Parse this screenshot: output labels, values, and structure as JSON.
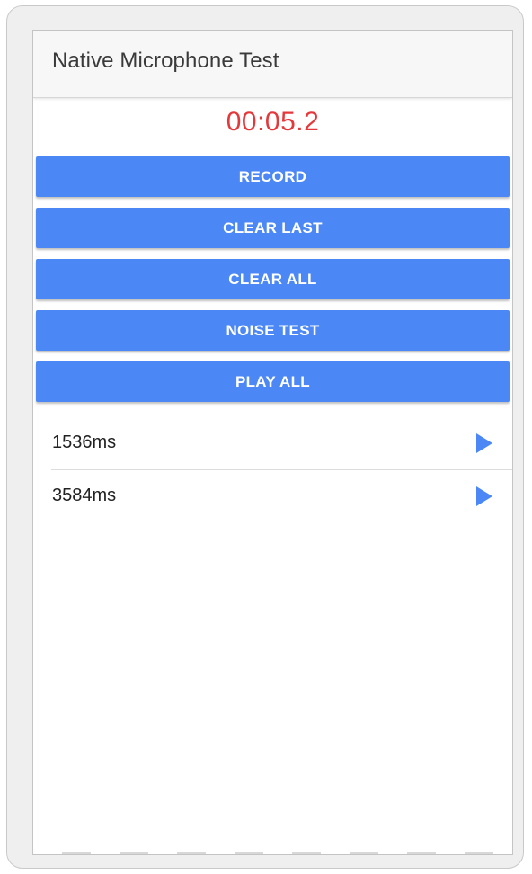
{
  "app": {
    "title": "Native Microphone Test"
  },
  "timer": {
    "value": "00:05.2",
    "color": "#e5383b"
  },
  "buttons": {
    "record": "RECORD",
    "clear_last": "CLEAR LAST",
    "clear_all": "CLEAR ALL",
    "noise_test": "NOISE TEST",
    "play_all": "PLAY ALL",
    "color": "#4b88f5"
  },
  "recordings": [
    {
      "duration": "1536ms",
      "icon": "play-icon"
    },
    {
      "duration": "3584ms",
      "icon": "play-icon"
    }
  ]
}
